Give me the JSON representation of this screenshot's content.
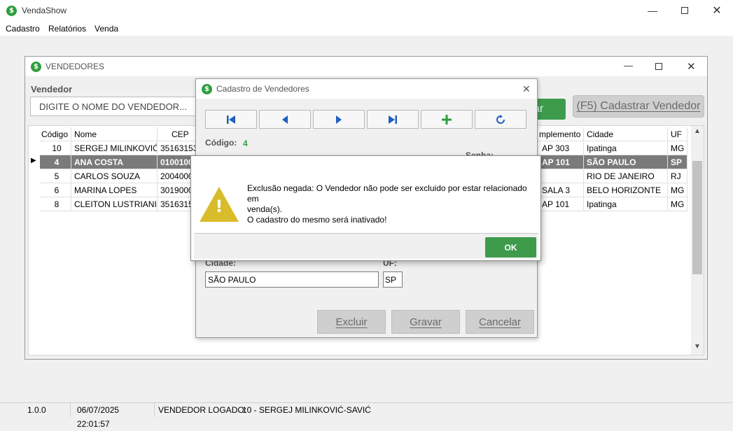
{
  "app": {
    "logo_glyph": "$",
    "title": "VendaShow"
  },
  "menu": [
    {
      "label": "Cadastro"
    },
    {
      "label": "Relatórios"
    },
    {
      "label": "Venda"
    }
  ],
  "vendedores": {
    "title": "VENDEDORES",
    "search_label": "Vendedor",
    "search_placeholder": "DIGITE O NOME DO VENDEDOR...",
    "filter_button_fragment": "ar",
    "register_button_label": "(F5) Cadastrar Vendedor",
    "columns_left": [
      "Código",
      "Nome",
      "CEP"
    ],
    "columns_right": [
      "mplemento",
      "Cidade",
      "UF"
    ],
    "rows": [
      {
        "code": "10",
        "name": "SERGEJ MILINKOVIĆ-SA",
        "cep": "35163153",
        "complement": "AP 303",
        "city": "Ipatinga",
        "uf": "MG"
      },
      {
        "code": "4",
        "name": "ANA COSTA",
        "cep": "0100100",
        "complement": "AP 101",
        "city": "SÃO PAULO",
        "uf": "SP"
      },
      {
        "code": "5",
        "name": "CARLOS SOUZA",
        "cep": "2004000",
        "complement": "",
        "city": "RIO DE JANEIRO",
        "uf": "RJ"
      },
      {
        "code": "6",
        "name": "MARINA LOPES",
        "cep": "3019000",
        "complement": "SALA 3",
        "city": "BELO HORIZONTE",
        "uf": "MG"
      },
      {
        "code": "8",
        "name": "CLEITON LUSTRIANI",
        "cep": "3516315",
        "complement": "AP 101",
        "city": "Ipatinga",
        "uf": "MG"
      }
    ],
    "selected_row": 1,
    "row_indicator": "▶"
  },
  "cadastro": {
    "title": "Cadastro de Vendedores",
    "codigo_label": "Código:",
    "codigo_value": "4",
    "partial_label": "Senha:",
    "cidade_label": "Cidade:",
    "cidade_value": "SÃO PAULO",
    "uf_label": "UF:",
    "uf_value": "SP",
    "excluir_label": "Excluir",
    "gravar_label": "Gravar",
    "cancelar_label": "Cancelar"
  },
  "dialog": {
    "message_line1": "Exclusão negada: O Vendedor não pode ser excluido por estar relacionado em",
    "message_line2": "venda(s).",
    "message_line3": "O cadastro do mesmo será inativado!",
    "ok_label": "OK",
    "warning_glyph": "!"
  },
  "statusbar": {
    "version": "1.0.0",
    "datetime": "06/07/2025 22:01:57",
    "user_label": "VENDEDOR LOGADO:",
    "user_value": "10 - SERGEJ MILINKOVIĆ-SAVIĆ"
  },
  "colors": {
    "accent_green": "#2e9e3e",
    "nav_blue": "#1f5fbf",
    "selected_row": "#7a7a7a",
    "warning_yellow": "#d9bc2a"
  }
}
